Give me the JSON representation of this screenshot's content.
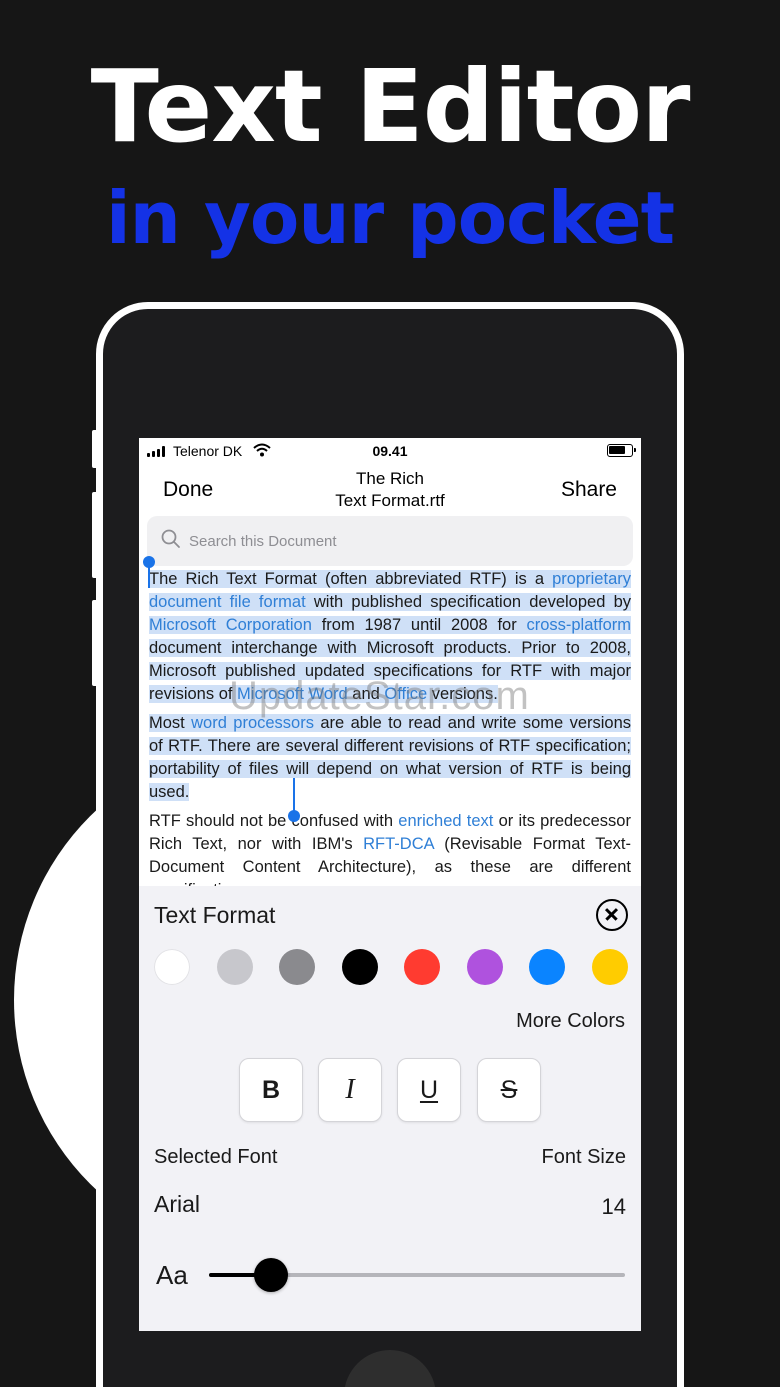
{
  "promo": {
    "headline": "Text Editor",
    "subline": "in your pocket"
  },
  "status_bar": {
    "carrier": "Telenor DK",
    "time": "09.41"
  },
  "nav": {
    "done": "Done",
    "title_line1": "The Rich",
    "title_line2": "Text Format.rtf",
    "share": "Share"
  },
  "search": {
    "placeholder": "Search this Document"
  },
  "document": {
    "p1": [
      {
        "t": "The Rich Text Format (often abbreviated RTF) is a ",
        "link": false
      },
      {
        "t": "proprietary document file format",
        "link": true
      },
      {
        "t": " with published specification developed by ",
        "link": false
      },
      {
        "t": "Microsoft Corporation",
        "link": true
      },
      {
        "t": " from 1987 until 2008 for ",
        "link": false
      },
      {
        "t": "cross-platform",
        "link": true
      },
      {
        "t": " document interchange with Microsoft products. Prior to 2008, Microsoft published updated specifications for RTF with major revisions of ",
        "link": false
      },
      {
        "t": "Microsoft Word",
        "link": true
      },
      {
        "t": " and ",
        "link": false
      },
      {
        "t": "Office",
        "link": true
      },
      {
        "t": " versions.",
        "link": false
      }
    ],
    "p2": [
      {
        "t": "Most ",
        "link": false
      },
      {
        "t": "word processors",
        "link": true
      },
      {
        "t": " are able to read and write some versions of RTF. There are several different revisions of RTF specification; portability of files will depend on what version of RTF is being used.",
        "link": false
      }
    ],
    "p3": [
      {
        "t": "RTF should not be confused with ",
        "link": false
      },
      {
        "t": "enriched text",
        "link": true
      },
      {
        "t": " or its predecessor Rich Text, nor with IBM's ",
        "link": false
      },
      {
        "t": "RFT-DCA",
        "link": true
      },
      {
        "t": " (Revisable Format Text-Document Content Architecture), as these are different specifications.",
        "link": false
      }
    ],
    "watermark": "UpdateStar.com"
  },
  "panel": {
    "title": "Text Format",
    "colors": [
      "#ffffff",
      "#c7c7cc",
      "#8a8a8e",
      "#000000",
      "#ff3b30",
      "#af52de",
      "#0a84ff",
      "#ffcc00"
    ],
    "more_colors": "More Colors",
    "format_buttons": {
      "bold": "B",
      "italic": "I",
      "underline": "U",
      "strikethrough": "S"
    },
    "selected_font_label": "Selected Font",
    "font_size_label": "Font Size",
    "selected_font": "Arial",
    "font_size": "14",
    "slider_label": "Aa",
    "slider_fraction": 0.15
  },
  "theme": {
    "accent": "#1432e6",
    "link": "#2f7fd6",
    "selection": "#cfe0f7"
  }
}
